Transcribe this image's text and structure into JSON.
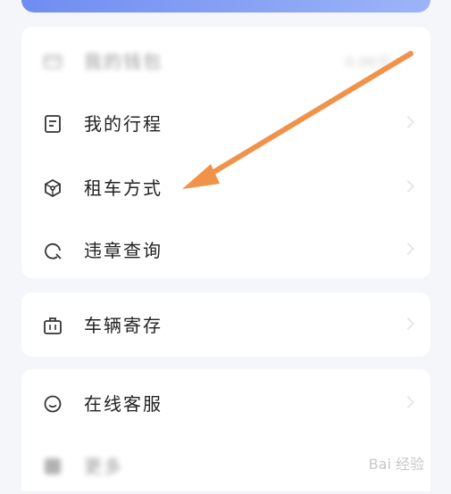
{
  "colors": {
    "accent": "#7b97f4",
    "arrow": "#f0924a",
    "text": "#222222",
    "card": "#ffffff",
    "background": "#f5f6fa"
  },
  "menu": {
    "section1": [
      {
        "label": "我的钱包",
        "icon": "wallet-icon",
        "value": "0.00元"
      },
      {
        "label": "我的行程",
        "icon": "document-icon"
      },
      {
        "label": "租车方式",
        "icon": "hexagon-icon"
      },
      {
        "label": "违章查询",
        "icon": "search-circle-icon"
      }
    ],
    "section2": [
      {
        "label": "车辆寄存",
        "icon": "briefcase-icon"
      }
    ],
    "section3": [
      {
        "label": "在线客服",
        "icon": "chat-icon"
      },
      {
        "label": "更多",
        "icon": "more-icon"
      }
    ]
  },
  "watermark": "Bai 经验"
}
